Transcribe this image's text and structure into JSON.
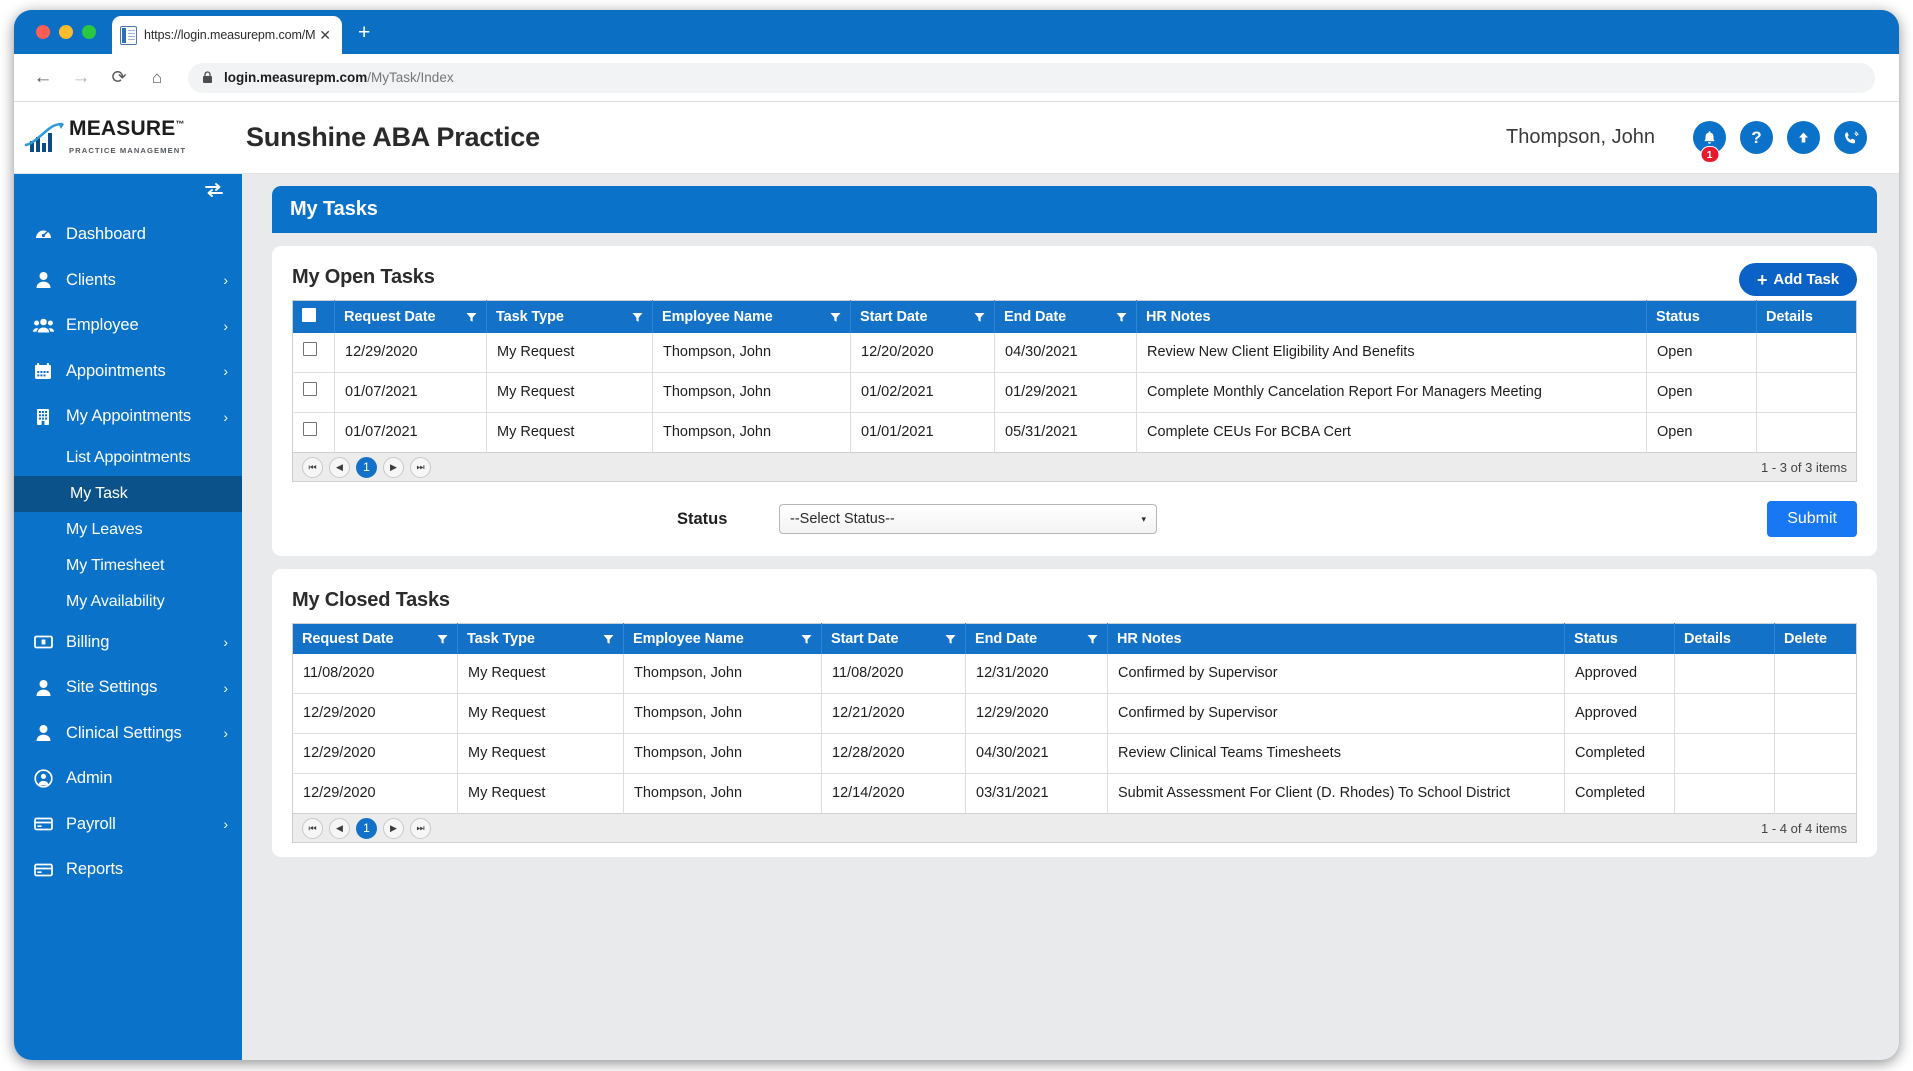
{
  "browser": {
    "tab_title": "https://login.measurepm.com/M",
    "tab_close_label": "✕",
    "new_tab_label": "+",
    "back_label": "←",
    "forward_label": "→",
    "reload_label": "⟳",
    "home_label": "⌂",
    "url_bold": "login.measurepm.com",
    "url_rest": "/MyTask/Index"
  },
  "header": {
    "logo_wordmark": "MEASURE",
    "logo_trademark": "™",
    "logo_tagline": "PRACTICE MANAGEMENT",
    "practice_title": "Sunshine ABA Practice",
    "user_name": "Thompson, John",
    "notification_count": "1",
    "help_label": "?",
    "icons": [
      "bell-icon",
      "help-icon",
      "upload-icon",
      "phone-call-icon"
    ]
  },
  "sidebar": {
    "collapse_label": "collapse-sidebar-icon",
    "items": [
      {
        "label": "Dashboard",
        "icon": "dashboard-icon",
        "caret": false
      },
      {
        "label": "Clients",
        "icon": "person-icon",
        "caret": true
      },
      {
        "label": "Employee",
        "icon": "people-group-icon",
        "caret": true
      },
      {
        "label": "Appointments",
        "icon": "calendar-icon",
        "caret": true
      },
      {
        "label": "My Appointments",
        "icon": "building-icon",
        "caret": true
      }
    ],
    "sub_items": [
      {
        "label": "List Appointments",
        "active": false
      },
      {
        "label": "My Task",
        "active": true
      },
      {
        "label": "My Leaves",
        "active": false
      },
      {
        "label": "My Timesheet",
        "active": false
      },
      {
        "label": "My Availability",
        "active": false
      }
    ],
    "items_after": [
      {
        "label": "Billing",
        "icon": "money-icon",
        "caret": true
      },
      {
        "label": "Site Settings",
        "icon": "person-icon",
        "caret": true
      },
      {
        "label": "Clinical Settings",
        "icon": "person-icon",
        "caret": true
      },
      {
        "label": "Admin",
        "icon": "user-circle-icon",
        "caret": false
      },
      {
        "label": "Payroll",
        "icon": "card-icon",
        "caret": true
      },
      {
        "label": "Reports",
        "icon": "card-icon",
        "caret": false
      }
    ],
    "caret_glyph": "›"
  },
  "page": {
    "title": "My Tasks"
  },
  "open_tasks": {
    "section_title": "My Open Tasks",
    "add_task_label": "Add Task",
    "add_task_plus": "+",
    "columns": [
      {
        "label": "",
        "filter": false
      },
      {
        "label": "Request Date",
        "filter": true
      },
      {
        "label": "Task Type",
        "filter": true
      },
      {
        "label": "Employee Name",
        "filter": true
      },
      {
        "label": "Start Date",
        "filter": true
      },
      {
        "label": "End Date",
        "filter": true
      },
      {
        "label": "HR Notes",
        "filter": false
      },
      {
        "label": "Status",
        "filter": false
      },
      {
        "label": "Details",
        "filter": false
      }
    ],
    "rows": [
      {
        "request_date": "12/29/2020",
        "task_type": "My Request",
        "employee_name": "Thompson, John",
        "start_date": "12/20/2020",
        "end_date": "04/30/2021",
        "hr_notes": "Review New Client Eligibility And Benefits",
        "status": "Open",
        "details": ""
      },
      {
        "request_date": "01/07/2021",
        "task_type": "My Request",
        "employee_name": "Thompson, John",
        "start_date": "01/02/2021",
        "end_date": "01/29/2021",
        "hr_notes": "Complete Monthly Cancelation Report For Managers Meeting",
        "status": "Open",
        "details": ""
      },
      {
        "request_date": "01/07/2021",
        "task_type": "My Request",
        "employee_name": "Thompson, John",
        "start_date": "01/01/2021",
        "end_date": "05/31/2021",
        "hr_notes": "Complete CEUs For BCBA Cert",
        "status": "Open",
        "details": ""
      }
    ],
    "pager": {
      "first_label": "⏮",
      "prev_label": "◀",
      "page_label": "1",
      "next_label": "▶",
      "last_label": "⏭",
      "count_text": "1 - 3 of 3 items"
    }
  },
  "status_form": {
    "label": "Status",
    "selected_value": "--Select Status--",
    "caret": "▾",
    "submit_label": "Submit"
  },
  "closed_tasks": {
    "section_title": "My Closed Tasks",
    "columns": [
      {
        "label": "Request Date",
        "filter": true
      },
      {
        "label": "Task Type",
        "filter": true
      },
      {
        "label": "Employee Name",
        "filter": true
      },
      {
        "label": "Start Date",
        "filter": true
      },
      {
        "label": "End Date",
        "filter": true
      },
      {
        "label": "HR Notes",
        "filter": false
      },
      {
        "label": "Status",
        "filter": false
      },
      {
        "label": "Details",
        "filter": false
      },
      {
        "label": "Delete",
        "filter": false
      }
    ],
    "rows": [
      {
        "request_date": "11/08/2020",
        "task_type": "My Request",
        "employee_name": "Thompson, John",
        "start_date": "11/08/2020",
        "end_date": "12/31/2020",
        "hr_notes": "Confirmed by Supervisor",
        "status": "Approved",
        "details": "",
        "delete": ""
      },
      {
        "request_date": "12/29/2020",
        "task_type": "My Request",
        "employee_name": "Thompson, John",
        "start_date": "12/21/2020",
        "end_date": "12/29/2020",
        "hr_notes": "Confirmed by Supervisor",
        "status": "Approved",
        "details": "",
        "delete": ""
      },
      {
        "request_date": "12/29/2020",
        "task_type": "My Request",
        "employee_name": "Thompson, John",
        "start_date": "12/28/2020",
        "end_date": "04/30/2021",
        "hr_notes": "Review Clinical Teams Timesheets",
        "status": "Completed",
        "details": "",
        "delete": ""
      },
      {
        "request_date": "12/29/2020",
        "task_type": "My Request",
        "employee_name": "Thompson, John",
        "start_date": "12/14/2020",
        "end_date": "03/31/2021",
        "hr_notes": "Submit Assessment For Client (D. Rhodes) To School District",
        "status": "Completed",
        "details": "",
        "delete": ""
      }
    ],
    "pager": {
      "first_label": "⏮",
      "prev_label": "◀",
      "page_label": "1",
      "next_label": "▶",
      "last_label": "⏭",
      "count_text": "1 - 4 of 4 items"
    }
  },
  "colors": {
    "brand_blue": "#0b72ca",
    "grid_header_blue": "#1471c8",
    "accent_button_blue": "#0a62c7",
    "submit_blue": "#1877f2",
    "badge_red": "#e8192c",
    "active_nav": "#0a5289"
  }
}
